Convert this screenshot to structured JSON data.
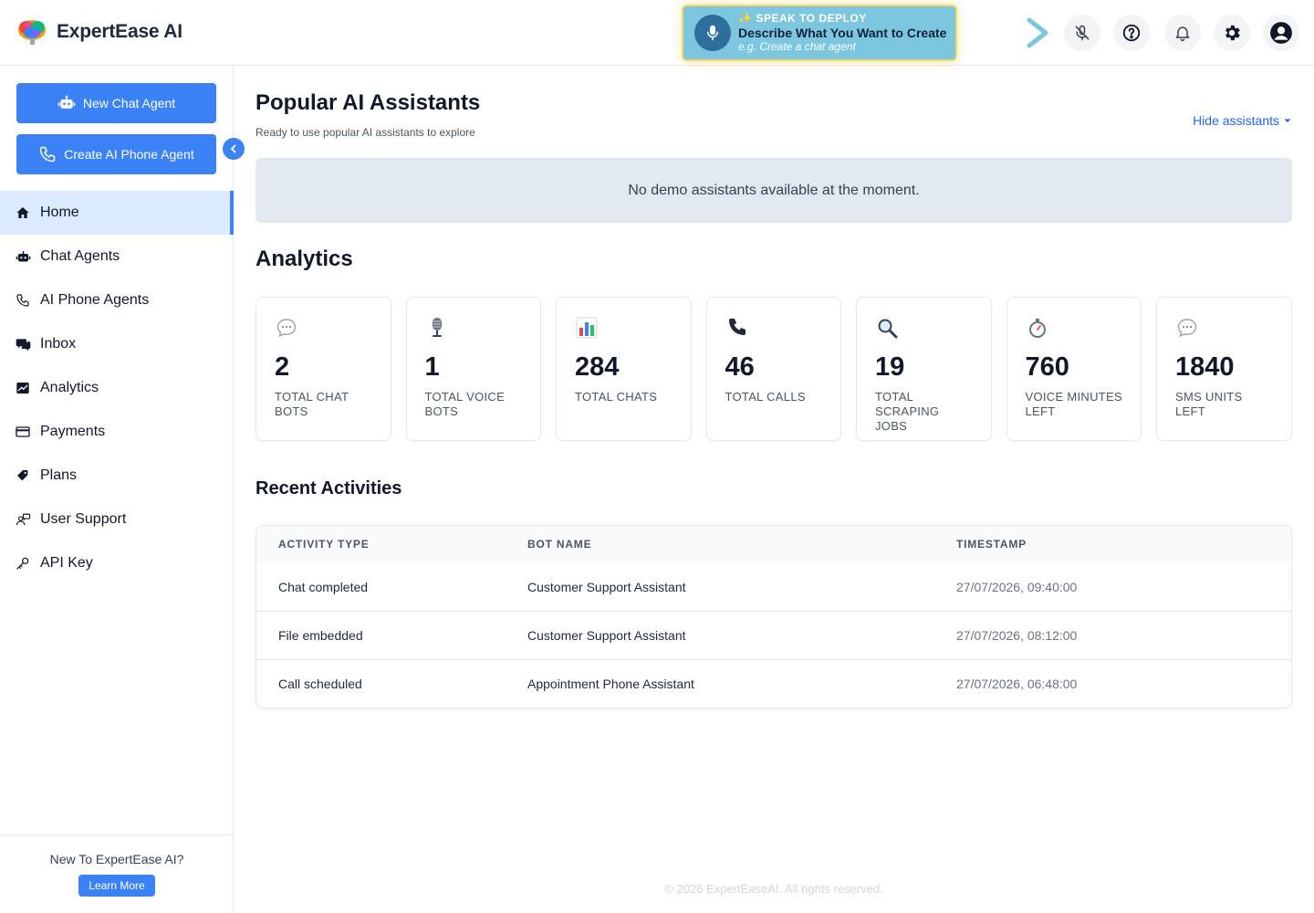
{
  "brand": {
    "name": "ExpertEase AI"
  },
  "voice_banner": {
    "eyebrow": "SPEAK TO DEPLOY",
    "title": "Describe What You Want to Create",
    "example": "e.g. Create a chat agent"
  },
  "header_icons": [
    "mic-off-icon",
    "help-icon",
    "bell-icon",
    "gear-icon",
    "user-icon"
  ],
  "sidebar": {
    "new_chat_agent": "New Chat Agent",
    "create_phone_agent": "Create AI Phone Agent",
    "items": [
      {
        "label": "Home",
        "icon": "home-icon",
        "active": true
      },
      {
        "label": "Chat Agents",
        "icon": "robot-icon"
      },
      {
        "label": "AI Phone Agents",
        "icon": "phone-icon"
      },
      {
        "label": "Inbox",
        "icon": "chat-bubbles-icon"
      },
      {
        "label": "Analytics",
        "icon": "chart-icon"
      },
      {
        "label": "Payments",
        "icon": "credit-card-icon"
      },
      {
        "label": "Plans",
        "icon": "tags-icon"
      },
      {
        "label": "User Support",
        "icon": "support-icon"
      },
      {
        "label": "API Key",
        "icon": "key-icon"
      }
    ],
    "footer_text": "New To ExpertEase AI?",
    "footer_button": "Learn More"
  },
  "main": {
    "title": "Popular AI Assistants",
    "subtitle": "Ready to use popular AI assistants to explore",
    "hide_link": "Hide assistants",
    "empty_message": "No demo assistants available at the moment.",
    "analytics_title": "Analytics",
    "cards": [
      {
        "value": "2",
        "label": "TOTAL CHAT BOTS",
        "icon": "speech-bubble-icon"
      },
      {
        "value": "1",
        "label": "TOTAL VOICE BOTS",
        "icon": "microphone-icon"
      },
      {
        "value": "284",
        "label": "TOTAL CHATS",
        "icon": "bar-chart-icon"
      },
      {
        "value": "46",
        "label": "TOTAL CALLS",
        "icon": "telephone-icon"
      },
      {
        "value": "19",
        "label": "TOTAL SCRAPING JOBS",
        "icon": "magnifier-icon"
      },
      {
        "value": "760",
        "label": "VOICE MINUTES LEFT",
        "icon": "stopwatch-icon"
      },
      {
        "value": "1840",
        "label": "SMS UNITS LEFT",
        "icon": "speech-bubble-icon"
      }
    ],
    "recent_title": "Recent Activities",
    "table": {
      "headers": [
        "ACTIVITY TYPE",
        "BOT NAME",
        "TIMESTAMP"
      ],
      "rows": [
        [
          "Chat completed",
          "Customer Support Assistant",
          "27/07/2026, 09:40:00"
        ],
        [
          "File embedded",
          "Customer Support Assistant",
          "27/07/2026, 08:12:00"
        ],
        [
          "Call scheduled",
          "Appointment Phone Assistant",
          "27/07/2026, 06:48:00"
        ]
      ]
    }
  },
  "footer": {
    "copyright": "© 2026 ExpertEaseAI. All rights reserved."
  },
  "colors": {
    "primary": "#3b82f6",
    "banner": "#7cc6df",
    "banner_border": "#f2d86b",
    "active_nav": "#dbeafe"
  }
}
